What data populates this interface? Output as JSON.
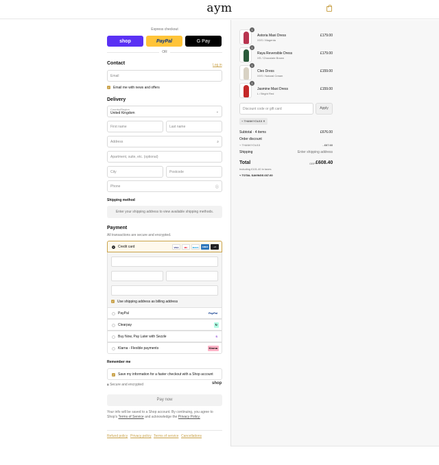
{
  "header": {
    "brand": "aym",
    "cart_icon": "shopping-bag-icon"
  },
  "express": {
    "title": "Express checkout",
    "buttons": {
      "shop": "shop",
      "paypal": "PayPal",
      "gpay": "G Pay"
    },
    "or_label": "OR"
  },
  "contact": {
    "heading": "Contact",
    "login_link": "Log in",
    "email_placeholder": "Email",
    "news_checkbox": "Email me with news and offers"
  },
  "delivery": {
    "heading": "Delivery",
    "country_label": "Country/Region",
    "country_value": "United Kingdom",
    "first_name": "First name",
    "last_name": "Last name",
    "address": "Address",
    "apartment": "Apartment, suite, etc. (optional)",
    "city": "City",
    "postcode": "Postcode",
    "phone": "Phone"
  },
  "shipping_method": {
    "heading": "Shipping method",
    "info": "Enter your shipping address to view available shipping methods."
  },
  "payment": {
    "heading": "Payment",
    "subtitle": "All transactions are secure and encrypted.",
    "credit_card": "Credit card",
    "card_logos": [
      "VISA",
      "MC",
      "MAES",
      "AMEX",
      "+4"
    ],
    "billing_checkbox": "Use shipping address as billing address",
    "options": [
      {
        "label": "PayPal",
        "badge": "PayPal"
      },
      {
        "label": "Clearpay",
        "badge": "↻"
      },
      {
        "label": "Buy Now, Pay Later with Sezzle",
        "badge": "S"
      },
      {
        "label": "Klarna - Flexible payments",
        "badge": "Klarna"
      }
    ]
  },
  "remember": {
    "heading": "Remember me",
    "checkbox": "Save my information for a faster checkout with a Shop account",
    "secure": "Secure and encrypted",
    "shop_logo": "shop"
  },
  "pay_now": "Pay now",
  "legal": {
    "text": "Your info will be saved to a Shop account. By continuing, you agree to Shop's",
    "terms": "Terms of Service",
    "and": "and acknowledge the",
    "privacy": "Privacy Policy."
  },
  "footer": {
    "refund": "Refund policy",
    "privacy": "Privacy policy",
    "terms": "Terms of service",
    "cancel": "Cancellations"
  },
  "cart": {
    "items": [
      {
        "name": "Astoria Maxi Dress",
        "variant": "XXS / Magenta",
        "price": "£179.00",
        "qty": "1",
        "color": "#b8344f"
      },
      {
        "name": "Raya Reversible Dress",
        "variant": "XS / Chocolate Brown",
        "price": "£179.00",
        "qty": "1",
        "color": "#2a5a3a"
      },
      {
        "name": "Cleo Dress",
        "variant": "XXS / Natural Cream",
        "price": "£159.00",
        "qty": "1",
        "color": "#d8d2c4"
      },
      {
        "name": "Jasmine Maxi Dress",
        "variant": "L / Bright Red",
        "price": "£159.00",
        "qty": "1",
        "color": "#c42828"
      }
    ],
    "discount_placeholder": "Discount code or gift card",
    "apply": "Apply",
    "code": "THANKYOU15",
    "subtotal_label": "Subtotal · 4 items",
    "subtotal": "£676.00",
    "order_discount_label": "Order discount",
    "order_discount_code": "THANKYOU15",
    "order_discount": "- £67.60",
    "shipping_label": "Shipping",
    "shipping_value": "Enter shipping address",
    "total_label": "Total",
    "currency": "GBP",
    "total": "£608.40",
    "tax": "Including £101.40 in taxes",
    "savings": "TOTAL SAVINGS £67.60"
  }
}
